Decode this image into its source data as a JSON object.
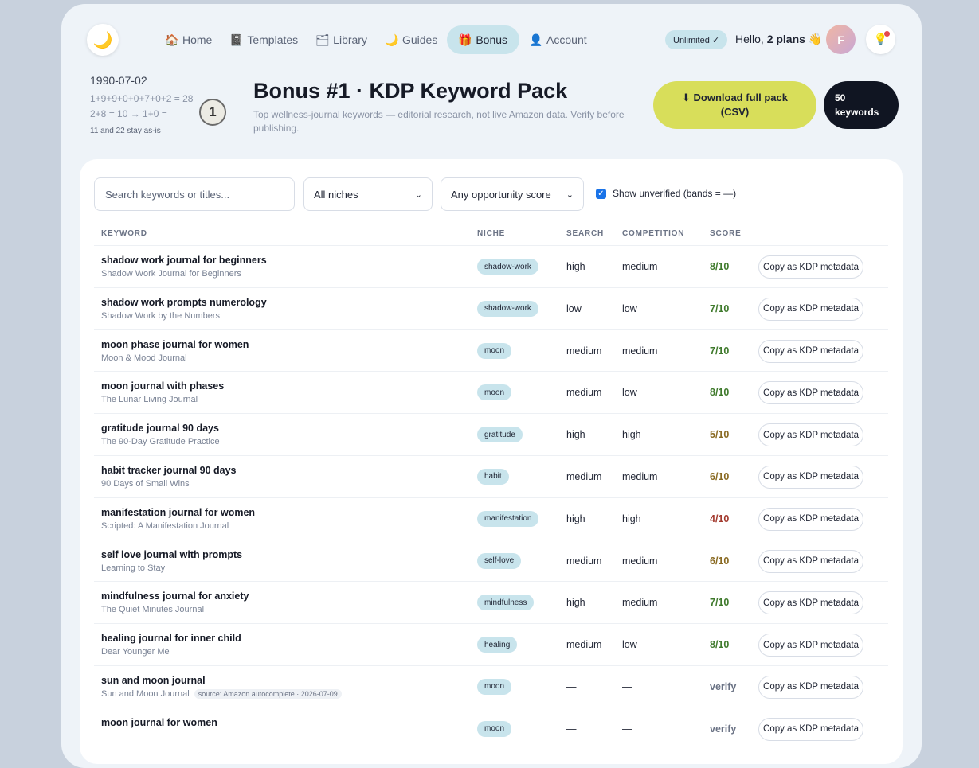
{
  "header": {
    "nav": [
      {
        "label": "Home",
        "icon": "🏠",
        "active": false
      },
      {
        "label": "Templates",
        "icon": "📓",
        "active": false
      },
      {
        "label": "Library",
        "icon": "🗂",
        "active": false
      },
      {
        "label": "Guides",
        "icon": "🌙",
        "active": false
      },
      {
        "label": "Bonus",
        "icon": "🎁",
        "active": true
      },
      {
        "label": "Account",
        "icon": "👤",
        "active": false
      }
    ],
    "plan_badge": "Unlimited ✓",
    "hello_prefix": "Hello, ",
    "hello_plans": "2 plans",
    "hello_emoji": "👋",
    "avatar_initial": "F",
    "logo_glyph": "🌙",
    "tip_glyph": "💡"
  },
  "numerology": {
    "date": "1990-07-02",
    "calc_line1": "1+9+9+0+0+7+0+2 = 28",
    "calc_line2": "2+8 = 10 → 1+0 =",
    "note": "11 and 22 stay as-is",
    "life_number": "1"
  },
  "page": {
    "title": "Bonus #1 · KDP Keyword Pack",
    "subtitle": "Top wellness-journal keywords — editorial research, not live Amazon data. Verify before publishing.",
    "download_label_1": "⬇ Download full pack",
    "download_label_2": "(CSV)",
    "keyword_count": "50",
    "keyword_count_label": "keywords"
  },
  "filters": {
    "search_placeholder": "Search keywords or titles...",
    "niche_select": "All niches",
    "score_select": "Any opportunity score",
    "show_unverified_label": "Show unverified (bands = —)",
    "show_unverified_checked": true
  },
  "table": {
    "headers": {
      "keyword": "KEYWORD",
      "niche": "NICHE",
      "search": "SEARCH",
      "competition": "COMPETITION",
      "score": "SCORE"
    },
    "copy_label": "Copy as KDP metadata",
    "rows": [
      {
        "keyword": "shadow work journal for beginners",
        "title": "Shadow Work Journal for Beginners",
        "source": "",
        "niche": "shadow-work",
        "search": "high",
        "competition": "medium",
        "score": "8/10",
        "score_color": "#3f7a2c"
      },
      {
        "keyword": "shadow work prompts numerology",
        "title": "Shadow Work by the Numbers",
        "source": "",
        "niche": "shadow-work",
        "search": "low",
        "competition": "low",
        "score": "7/10",
        "score_color": "#3f7a2c"
      },
      {
        "keyword": "moon phase journal for women",
        "title": "Moon & Mood Journal",
        "source": "",
        "niche": "moon",
        "search": "medium",
        "competition": "medium",
        "score": "7/10",
        "score_color": "#3f7a2c"
      },
      {
        "keyword": "moon journal with phases",
        "title": "The Lunar Living Journal",
        "source": "",
        "niche": "moon",
        "search": "medium",
        "competition": "low",
        "score": "8/10",
        "score_color": "#3f7a2c"
      },
      {
        "keyword": "gratitude journal 90 days",
        "title": "The 90-Day Gratitude Practice",
        "source": "",
        "niche": "gratitude",
        "search": "high",
        "competition": "high",
        "score": "5/10",
        "score_color": "#8a6a22"
      },
      {
        "keyword": "habit tracker journal 90 days",
        "title": "90 Days of Small Wins",
        "source": "",
        "niche": "habit",
        "search": "medium",
        "competition": "medium",
        "score": "6/10",
        "score_color": "#8a6a22"
      },
      {
        "keyword": "manifestation journal for women",
        "title": "Scripted: A Manifestation Journal",
        "source": "",
        "niche": "manifestation",
        "search": "high",
        "competition": "high",
        "score": "4/10",
        "score_color": "#a33a2e"
      },
      {
        "keyword": "self love journal with prompts",
        "title": "Learning to Stay",
        "source": "",
        "niche": "self-love",
        "search": "medium",
        "competition": "medium",
        "score": "6/10",
        "score_color": "#8a6a22"
      },
      {
        "keyword": "mindfulness journal for anxiety",
        "title": "The Quiet Minutes Journal",
        "source": "",
        "niche": "mindfulness",
        "search": "high",
        "competition": "medium",
        "score": "7/10",
        "score_color": "#3f7a2c"
      },
      {
        "keyword": "healing journal for inner child",
        "title": "Dear Younger Me",
        "source": "",
        "niche": "healing",
        "search": "medium",
        "competition": "low",
        "score": "8/10",
        "score_color": "#3f7a2c"
      },
      {
        "keyword": "sun and moon journal",
        "title": "Sun and Moon Journal",
        "source": "source: Amazon autocomplete · 2026-07-09",
        "niche": "moon",
        "search": "—",
        "competition": "—",
        "score": "verify",
        "score_color": "#6b7385"
      },
      {
        "keyword": "moon journal for women",
        "title": "",
        "source": "",
        "niche": "moon",
        "search": "—",
        "competition": "—",
        "score": "verify",
        "score_color": "#6b7385"
      }
    ]
  }
}
